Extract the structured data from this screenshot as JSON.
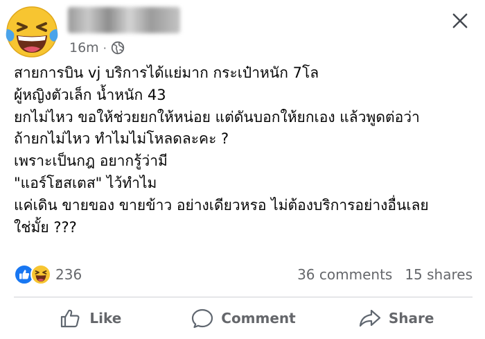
{
  "post": {
    "time": "16m",
    "separator": "·",
    "lines": [
      "สายการบิน vj บริการได้แย่มาก กระเป๋าหนัก 7โล",
      "ผู้หญิงตัวเล็ก น้ำหนัก 43",
      "ยกไม่ไหว ขอให้ช่วยยกให้หน่อย แต่ดันบอกให้ยกเอง แล้วพูดต่อว่า",
      "ถ้ายกไม่ไหว ทำไมไม่โหลดละคะ ?",
      "เพราะเป็นกฎ อยากรู้ว่ามี",
      "\"แอร์โฮสเตส\" ไว้ทำไม",
      "แค่เดิน ขายของ ขายข้าว อย่างเดียวหรอ ไม่ต้องบริการอย่างอื่นเลย",
      "ใช่มั้ย ???"
    ]
  },
  "stats": {
    "reaction_count": "236",
    "comments": "36 comments",
    "shares": "15 shares"
  },
  "actions": {
    "like": "Like",
    "comment": "Comment",
    "share": "Share"
  },
  "icons": {
    "avatar": "laughing-tears-emoji-icon",
    "privacy": "globe-icon",
    "close": "close-icon",
    "reactions": [
      "like-reaction-icon",
      "haha-reaction-icon"
    ],
    "actions": [
      "thumbs-up-icon",
      "comment-bubble-icon",
      "share-arrow-icon"
    ]
  },
  "colors": {
    "text": "#050505",
    "muted": "#65676b",
    "like_blue": "#1877f2",
    "emoji_yellow": "#f7c531",
    "tears_blue": "#4aa3ea"
  }
}
